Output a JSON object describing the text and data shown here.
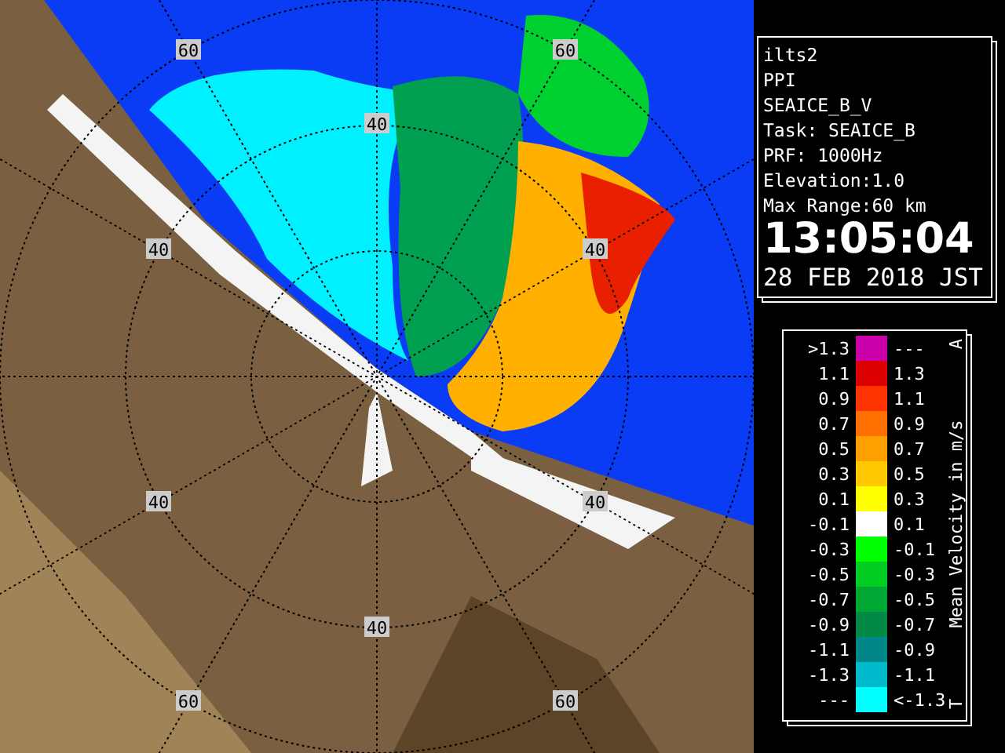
{
  "map": {
    "range_labels": [
      "60",
      "40",
      "60",
      "40",
      "40",
      "40",
      "40",
      "40",
      "60",
      "60"
    ]
  },
  "info": {
    "lines": [
      "ilts2",
      "PPI",
      "SEAICE_B_V",
      "Task: SEAICE_B",
      "PRF: 1000Hz",
      "Elevation:1.0",
      "Max Range:60 km"
    ],
    "time": "13:05:04",
    "date": "28 FEB 2018 JST"
  },
  "legend": {
    "title": "Mean Velocity in m/s",
    "end_bottom": "T",
    "end_top": "A",
    "rows": [
      {
        "low": ">1.3",
        "high": "---",
        "color": "#cc00aa"
      },
      {
        "low": "1.1",
        "high": "1.3",
        "color": "#dd0000"
      },
      {
        "low": "0.9",
        "high": "1.1",
        "color": "#ff3300"
      },
      {
        "low": "0.7",
        "high": "0.9",
        "color": "#ff7000"
      },
      {
        "low": "0.5",
        "high": "0.7",
        "color": "#ffa000"
      },
      {
        "low": "0.3",
        "high": "0.5",
        "color": "#ffc800"
      },
      {
        "low": "0.1",
        "high": "0.3",
        "color": "#ffff00"
      },
      {
        "low": "-0.1",
        "high": "0.1",
        "color": "#ffffff"
      },
      {
        "low": "-0.3",
        "high": "-0.1",
        "color": "#00ff00"
      },
      {
        "low": "-0.5",
        "high": "-0.3",
        "color": "#00cc22"
      },
      {
        "low": "-0.7",
        "high": "-0.5",
        "color": "#00a833"
      },
      {
        "low": "-0.9",
        "high": "-0.7",
        "color": "#008844"
      },
      {
        "low": "-1.1",
        "high": "-0.9",
        "color": "#008888"
      },
      {
        "low": "-1.3",
        "high": "-1.1",
        "color": "#00bbcc"
      },
      {
        "low": "---",
        "high": "<-1.3",
        "color": "#00ffff"
      }
    ]
  }
}
